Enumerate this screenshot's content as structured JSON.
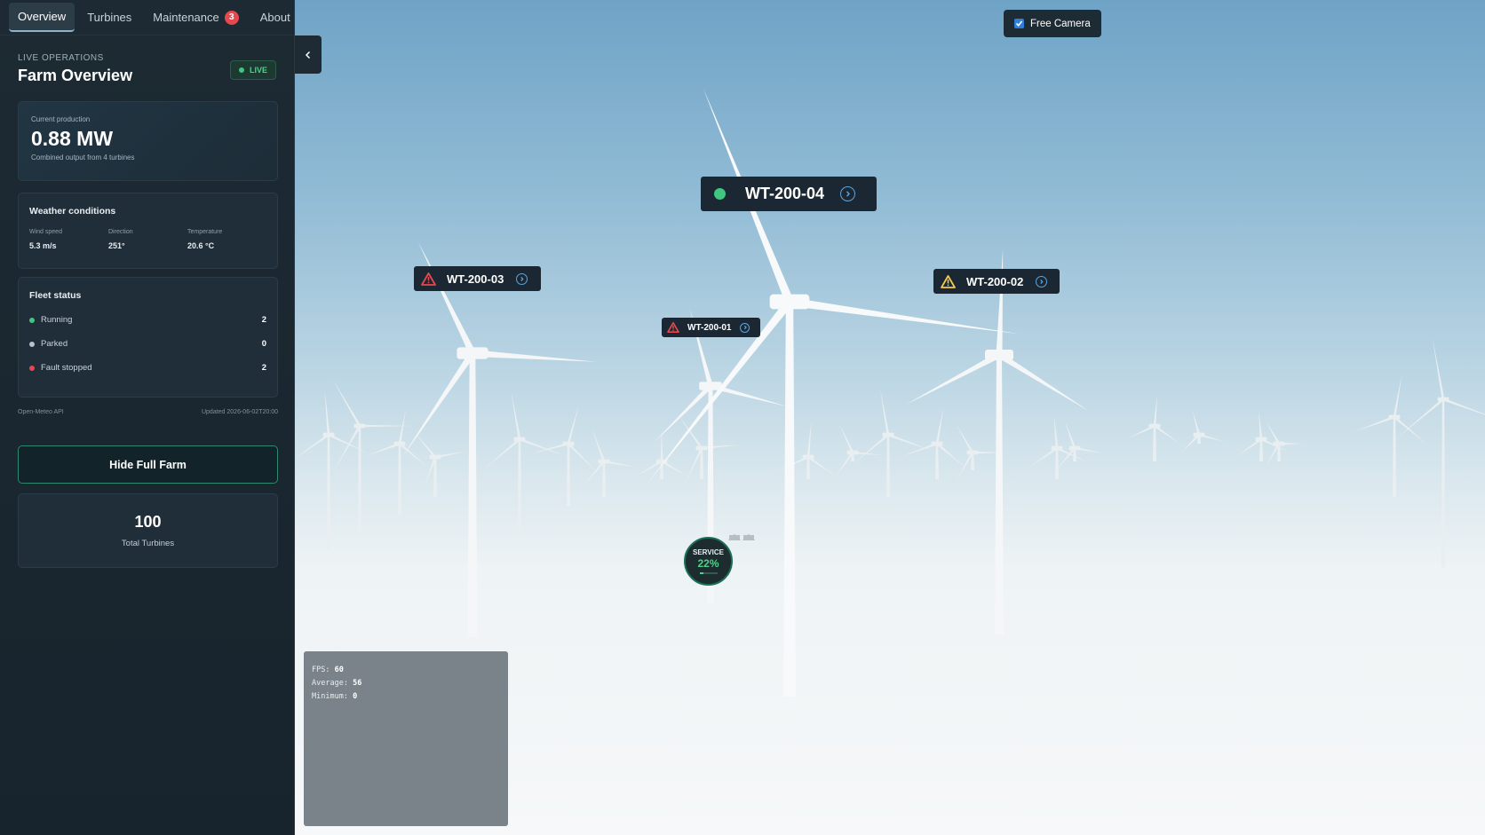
{
  "tabs": [
    {
      "label": "Overview",
      "active": true
    },
    {
      "label": "Turbines",
      "active": false
    },
    {
      "label": "Maintenance",
      "active": false,
      "badge": "3"
    },
    {
      "label": "About",
      "active": false
    }
  ],
  "header": {
    "eyebrow": "LIVE OPERATIONS",
    "title": "Farm Overview",
    "live_badge": "LIVE"
  },
  "production": {
    "label": "Current production",
    "value": "0.88 MW",
    "caption": "Combined output from 4 turbines"
  },
  "weather": {
    "title": "Weather conditions",
    "wind_label": "Wind speed",
    "wind_value": "5.3 m/s",
    "direction_label": "Direction",
    "direction_value": "251°",
    "temperature_label": "Temperature",
    "temperature_value": "20.6 °C"
  },
  "fleet": {
    "title": "Fleet status",
    "rows": [
      {
        "label": "Running",
        "count": "2",
        "color": "#3fc77f"
      },
      {
        "label": "Parked",
        "count": "0",
        "color": "#b8c2c8"
      },
      {
        "label": "Fault stopped",
        "count": "2",
        "color": "#e5484d"
      }
    ]
  },
  "footer": {
    "source": "Open-Meteo API",
    "updated": "Updated 2026-06-02T20:00"
  },
  "hide_farm_button": "Hide Full Farm",
  "total": {
    "value": "100",
    "label": "Total Turbines"
  },
  "free_camera": {
    "label": "Free Camera",
    "checked": true
  },
  "turbine_labels": [
    {
      "id": "WT-200-04",
      "status": "running",
      "icon": "status-dot-icon"
    },
    {
      "id": "WT-200-03",
      "status": "fault",
      "icon": "alert-triangle-icon"
    },
    {
      "id": "WT-200-02",
      "status": "warning",
      "icon": "warning-triangle-icon"
    },
    {
      "id": "WT-200-01",
      "status": "fault",
      "icon": "alert-triangle-icon"
    }
  ],
  "service": {
    "label": "SERVICE",
    "percent": "22%",
    "progress": 0.22
  },
  "fps": {
    "fps_label": "FPS:",
    "fps_value": "60",
    "avg_label": "Average:",
    "avg_value": "56",
    "min_label": "Minimum:",
    "min_value": "0"
  },
  "colors": {
    "running": "#3fc77f",
    "fault": "#e5484d",
    "warning": "#f2c94c",
    "accent": "#5aa6e0"
  }
}
